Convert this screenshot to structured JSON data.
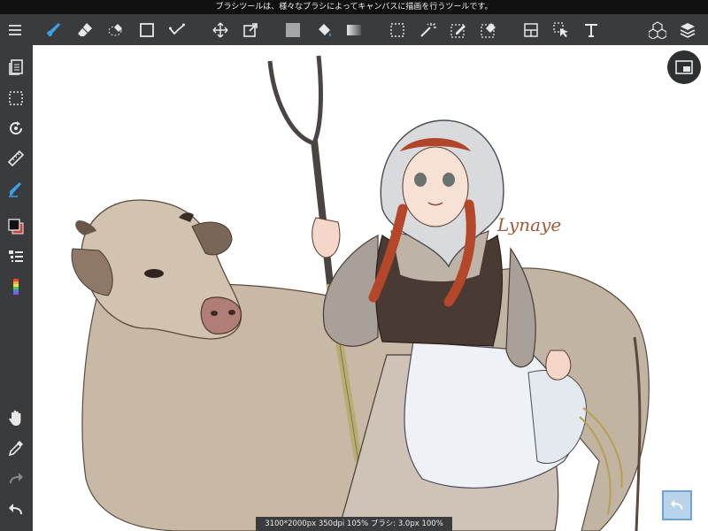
{
  "tooltip": {
    "text": "ブラシツールは、様々なブラシによってキャンバスに描画を行うツールです。"
  },
  "colors": {
    "accent": "#39a1e8",
    "ui_bg": "#3a3b3d",
    "icon": "#e8e8e8",
    "canvas": "#ffffff"
  },
  "toolbar": {
    "items": [
      "menu-icon",
      "brush-icon",
      "eraser-icon",
      "lasso-eraser-icon",
      "rectangle-icon",
      "snap-icon",
      "move-icon",
      "transform-icon",
      "fill-color-icon",
      "bucket-icon",
      "gradient-icon",
      "selection-icon",
      "magic-wand-icon",
      "select-pen-icon",
      "select-eraser-icon",
      "layout-icon",
      "select-arrow-icon",
      "text-icon",
      "material-icon",
      "layers-icon"
    ]
  },
  "sidebar": {
    "items": [
      "pages-icon",
      "selection-tool-icon",
      "rotate-icon",
      "ruler-icon",
      "brush-tool-icon",
      "color-icon",
      "brush-size-icon",
      "palette-icon",
      "hand-icon",
      "eyedropper-icon",
      "redo-icon",
      "undo-icon"
    ]
  },
  "canvas": {
    "signature": "Lynaye"
  },
  "status": {
    "text": "3100*2000px 350dpi 105% ブラシ: 3.0px 100%"
  }
}
